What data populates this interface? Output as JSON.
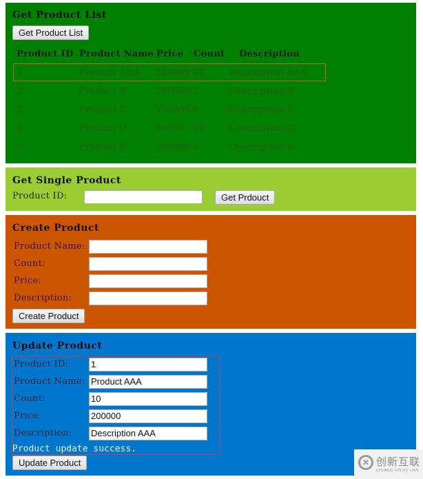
{
  "get_list": {
    "title": "Get Product List",
    "button_label": "Get Product List",
    "columns": [
      "Product ID",
      "Product Name",
      "Price",
      "Count",
      "Description"
    ],
    "rows": [
      {
        "id": "1",
        "name": "Product AAA",
        "price": "200000",
        "count": "10",
        "description": "Description AAA"
      },
      {
        "id": "2",
        "name": "Product B",
        "price": "200000",
        "count": "2",
        "description": "Description B"
      },
      {
        "id": "3",
        "name": "Product C",
        "price": "500000",
        "count": "8",
        "description": "Description C"
      },
      {
        "id": "4",
        "name": "Product D",
        "price": "80000",
        "count": "10",
        "description": "Description D"
      },
      {
        "id": "5",
        "name": "Product E",
        "price": "300000",
        "count": "3",
        "description": "Description E"
      }
    ],
    "highlighted_row": 0
  },
  "get_single": {
    "title": "Get Single Product",
    "id_label": "Product ID:",
    "id_value": "",
    "button_label": "Get Prdouct"
  },
  "create": {
    "title": "Create Product",
    "fields": [
      {
        "label": "Product Name:",
        "value": ""
      },
      {
        "label": "Count:",
        "value": ""
      },
      {
        "label": "Price:",
        "value": ""
      },
      {
        "label": "Description:",
        "value": ""
      }
    ],
    "button_label": "Create Product"
  },
  "update": {
    "title": "Update Product",
    "fields": [
      {
        "label": "Product ID:",
        "value": "1"
      },
      {
        "label": "Product Name:",
        "value": "Product AAA"
      },
      {
        "label": "Count:",
        "value": "10"
      },
      {
        "label": "Price:",
        "value": "200000"
      },
      {
        "label": "Description:",
        "value": "Description AAA"
      }
    ],
    "status_message": "Product update success.",
    "button_label": "Update Product"
  },
  "watermark": {
    "logo_glyph": "✕",
    "text": "创新互联",
    "subtext": "CHUANG XIN HU LIAN"
  },
  "colors": {
    "list_bg": "#008000",
    "single_bg": "#9acd32",
    "create_bg": "#cc5500",
    "update_bg": "#0077cc",
    "highlight_border": "#c06a1a",
    "update_outline": "#c0405a"
  }
}
